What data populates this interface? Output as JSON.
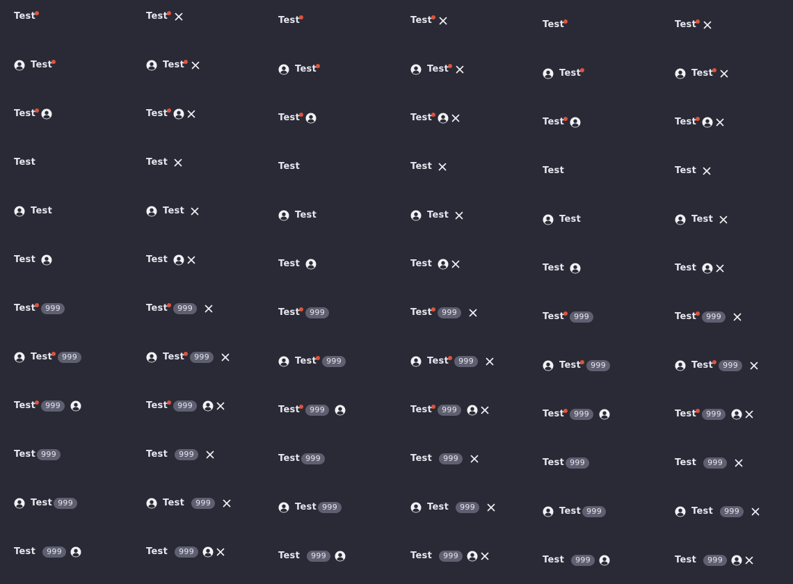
{
  "tab_label": "Test",
  "badge_count": "999",
  "colors": {
    "background": "#2a2a36",
    "text": "#e6e6ee",
    "dot": "#e0543a",
    "badge_bg": "#5e5f70"
  },
  "columns": [
    {
      "closable": false
    },
    {
      "closable": true
    },
    {
      "closable": false
    },
    {
      "closable": true
    },
    {
      "closable": false
    },
    {
      "closable": true
    }
  ],
  "rows": [
    {
      "dot": true,
      "icon": "none",
      "badge": false
    },
    {
      "dot": true,
      "icon": "start",
      "badge": false
    },
    {
      "dot": true,
      "icon": "end",
      "badge": false
    },
    {
      "dot": false,
      "icon": "none",
      "badge": false
    },
    {
      "dot": false,
      "icon": "start",
      "badge": false
    },
    {
      "dot": false,
      "icon": "end",
      "badge": false
    },
    {
      "dot": true,
      "icon": "none",
      "badge": true
    },
    {
      "dot": true,
      "icon": "start",
      "badge": true
    },
    {
      "dot": true,
      "icon": "end",
      "badge": true
    },
    {
      "dot": false,
      "icon": "none",
      "badge": true
    },
    {
      "dot": false,
      "icon": "start",
      "badge": true
    },
    {
      "dot": false,
      "icon": "end",
      "badge": true
    }
  ]
}
